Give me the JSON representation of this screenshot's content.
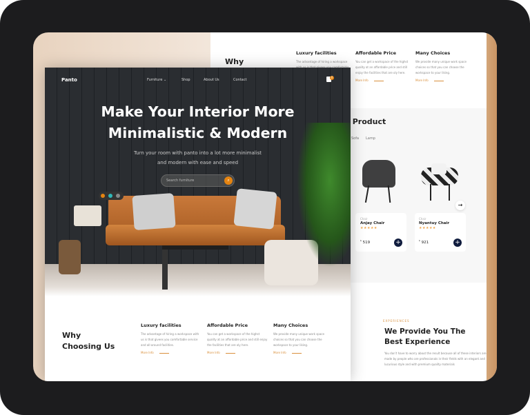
{
  "back": {
    "why": "Why",
    "features": [
      {
        "title": "Luxury facilities",
        "text": "The advantage of hiring a workspace with us is that givees you comfortable service and all-around facilities.",
        "more": "More Info"
      },
      {
        "title": "Affordable Price",
        "text": "You can get a workspace of the highst quality at an affordable price and still enjoy the facilities that are oly here.",
        "more": "More Info"
      },
      {
        "title": "Many Choices",
        "text": "We provide many unique work space choices so that you can choose the workspace to your liking.",
        "more": "More Info"
      }
    ],
    "product_title": "g Product",
    "tabs": [
      "Sofa",
      "Lamp"
    ],
    "products": [
      {
        "category": "Chair",
        "name": "Anjay Chair",
        "rating": 5,
        "currency": "$",
        "price": "519"
      },
      {
        "category": "Chair",
        "name": "Nyantuy Chair",
        "rating": 5,
        "currency": "$",
        "price": "921"
      }
    ],
    "experiences_label": "EXPERIENCES",
    "experience_title_1": "We Provide You The",
    "experience_title_2": "Best Experience",
    "experience_text": "You don't have to worry about the result because all of these interiors are made by people who are professionals in their fields with an elegant and lucurious style and with premium quality materials"
  },
  "front": {
    "logo": "Panto",
    "nav": [
      "Furniture",
      "Shop",
      "About Us",
      "Contact"
    ],
    "cart_count": "0",
    "title_1": "Make Your Interior More",
    "title_2": "Minimalistic & Modern",
    "subtitle_1": "Turn your room with panto into a lot more minimalist",
    "subtitle_2": "and modern with ease and speed",
    "search_placeholder": "Search furniture",
    "why_1": "Why",
    "why_2": "Choosing Us",
    "features": [
      {
        "title": "Luxury facilities",
        "text": "The advantage of hiring a workspace with us is that givees you comfortable service and all-around facilities.",
        "more": "More Info"
      },
      {
        "title": "Affordable Price",
        "text": "You can get a workspace of the highst quality at an affordable price and still enjoy the facilities that are oly here.",
        "more": "More Info"
      },
      {
        "title": "Many Choices",
        "text": "We provide many unique work space choices so that you can choose the workspace to your liking.",
        "more": "More Info"
      }
    ]
  },
  "colors": {
    "accent": "#E58411",
    "navy": "#0F1B3D",
    "sofa": "#C0722E",
    "star": "#F0A448"
  }
}
